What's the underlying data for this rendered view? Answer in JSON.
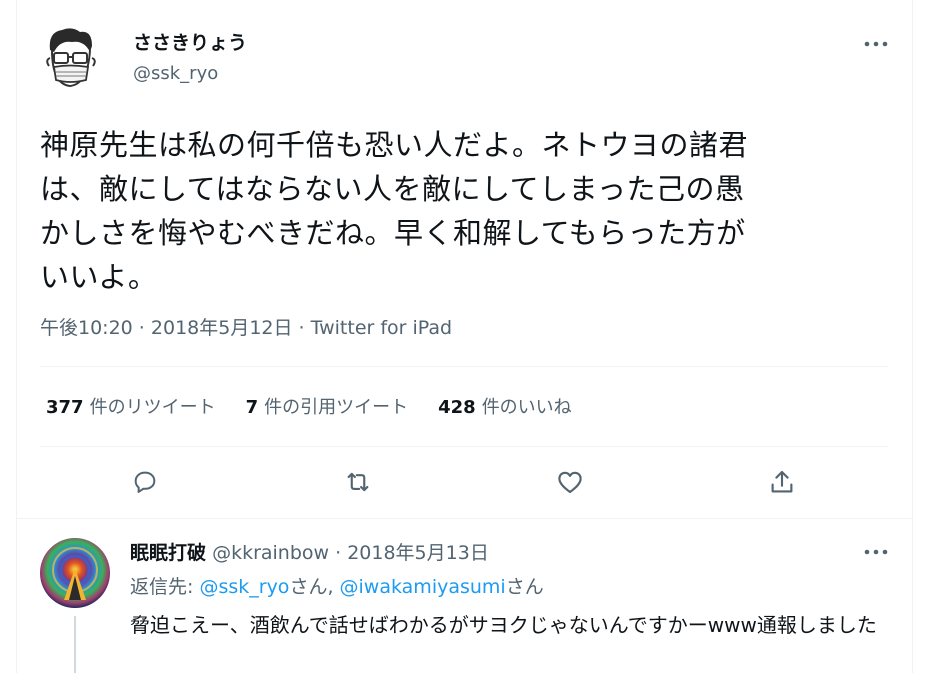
{
  "tweet": {
    "author": {
      "display_name": "ささきりょう",
      "handle": "@ssk_ryo"
    },
    "text": "神原先生は私の何千倍も恐い人だよ。ネトウヨの諸君\nは、敵にしてはならない人を敵にしてしまった己の愚\nかしさを悔やむべきだね。早く和解してもらった方が\nいいよ。",
    "time": "午後10:20",
    "date": "2018年5月12日",
    "client": "Twitter for iPad",
    "separator": " · ",
    "stats": {
      "retweets_count": "377",
      "retweets_label": "件のリツイート",
      "quotes_count": "7",
      "quotes_label": "件の引用ツイート",
      "likes_count": "428",
      "likes_label": "件のいいね"
    }
  },
  "reply": {
    "display_name": "眠眠打破",
    "handle": "@kkrainbow",
    "separator": " · ",
    "date": "2018年5月13日",
    "replying_prefix": "返信先: ",
    "mention_1": "@ssk_ryo",
    "mention_1_suffix": "さん, ",
    "mention_2": "@iwakamiyasumi",
    "mention_2_suffix": "さん",
    "text": "脅迫こえー、酒飲んで話せばわかるがサヨクじゃないんですかーwww通報しました"
  },
  "icons": {
    "more": "more-horizontal-icon",
    "reply": "reply-bubble-icon",
    "retweet": "retweet-icon",
    "like": "heart-icon",
    "share": "share-icon"
  },
  "colors": {
    "text_primary": "#0f1419",
    "text_secondary": "#536471",
    "link": "#1d9bf0",
    "divider": "#eff3f4"
  }
}
